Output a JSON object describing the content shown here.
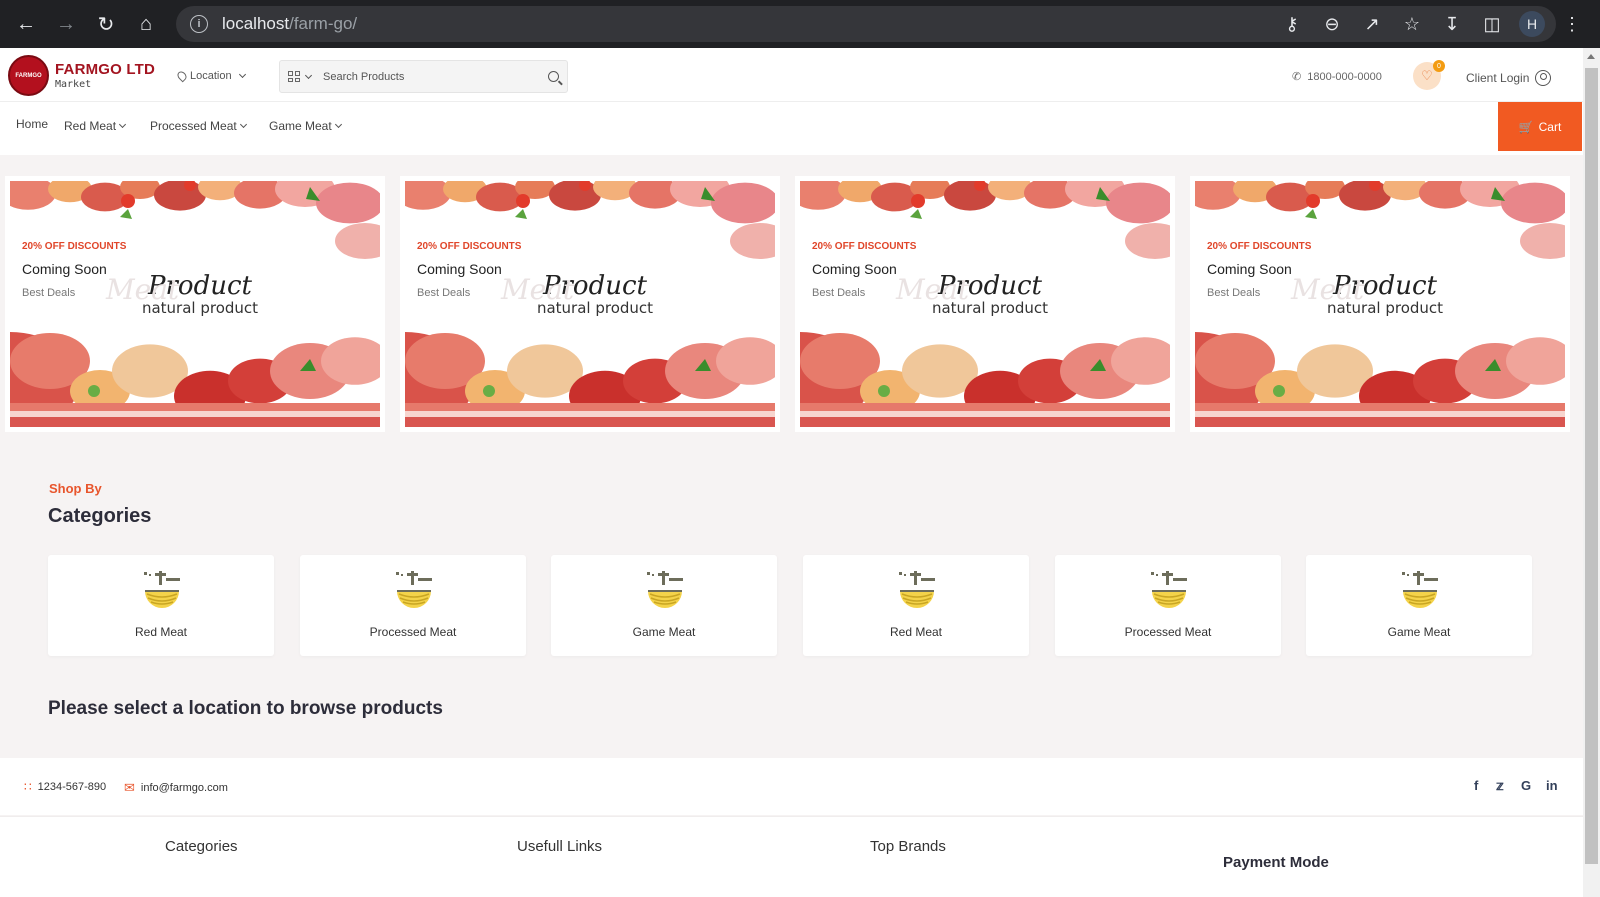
{
  "browser": {
    "url_host": "localhost",
    "url_path": "/farm-go/",
    "profile_initial": "H"
  },
  "header": {
    "brand_title": "FARMGO LTD",
    "brand_sub": "Market",
    "logo_text": "FARMGO",
    "location_label": "Location",
    "search_placeholder": "Search Products",
    "phone": "1800-000-0000",
    "wishlist_count": "0",
    "client_login": "Client Login"
  },
  "nav": {
    "items": [
      {
        "label": "Home"
      },
      {
        "label": "Red Meat"
      },
      {
        "label": "Processed Meat"
      },
      {
        "label": "Game Meat"
      }
    ],
    "cart_label": "Cart"
  },
  "banners": [
    {
      "tag": "20% OFF DISCOUNTS",
      "title": "Coming Soon",
      "sub": "Best Deals",
      "script_big": "Product",
      "script_ghost": "Meat",
      "script_small": "natural product"
    },
    {
      "tag": "20% OFF DISCOUNTS",
      "title": "Coming Soon",
      "sub": "Best Deals",
      "script_big": "Product",
      "script_ghost": "Meat",
      "script_small": "natural product"
    },
    {
      "tag": "20% OFF DISCOUNTS",
      "title": "Coming Soon",
      "sub": "Best Deals",
      "script_big": "Product",
      "script_ghost": "Meat",
      "script_small": "natural product"
    },
    {
      "tag": "20% OFF DISCOUNTS",
      "title": "Coming Soon",
      "sub": "Best Deals",
      "script_big": "Product",
      "script_ghost": "Meat",
      "script_small": "natural product"
    }
  ],
  "categories": {
    "eyebrow": "Shop By",
    "heading": "Categories",
    "items": [
      {
        "label": "Red Meat",
        "icon": "noodle-bowl-icon"
      },
      {
        "label": "Processed Meat",
        "icon": "noodle-bowl-icon"
      },
      {
        "label": "Game Meat",
        "icon": "noodle-bowl-icon"
      },
      {
        "label": "Red Meat",
        "icon": "noodle-bowl-icon"
      },
      {
        "label": "Processed Meat",
        "icon": "noodle-bowl-icon"
      },
      {
        "label": "Game Meat",
        "icon": "noodle-bowl-icon"
      }
    ]
  },
  "notice": "Please select a location to browse products",
  "contact": {
    "phone": "1234-567-890",
    "email": "info@farmgo.com"
  },
  "social": [
    "facebook-icon",
    "twitter-icon",
    "google-icon",
    "linkedin-icon"
  ],
  "footer": {
    "col1": "Categories",
    "col2": "Usefull Links",
    "col3": "Top Brands",
    "col4": "Payment Mode"
  },
  "colors": {
    "accent": "#f15a22",
    "brand_red": "#a31420",
    "discount": "#e0462a",
    "page_bg": "#f6f3f3"
  }
}
